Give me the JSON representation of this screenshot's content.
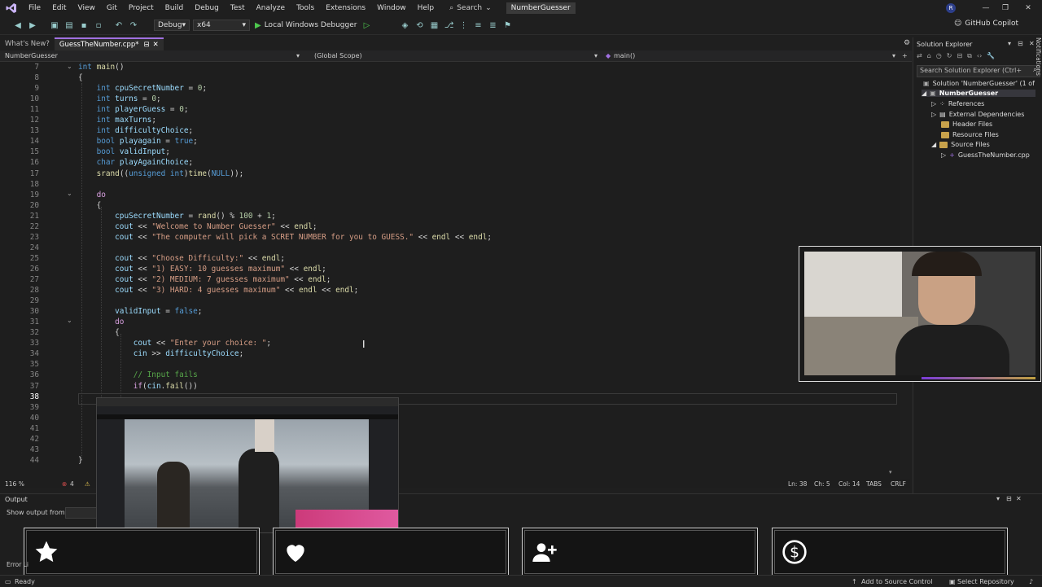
{
  "menubar": {
    "items": [
      "File",
      "Edit",
      "View",
      "Git",
      "Project",
      "Build",
      "Debug",
      "Test",
      "Analyze",
      "Tools",
      "Extensions",
      "Window",
      "Help"
    ],
    "search_label": "Search",
    "solution_title": "NumberGuesser",
    "avatar": "R",
    "copilot_label": "GitHub Copilot"
  },
  "toolbar": {
    "config": "Debug",
    "platform": "x64",
    "run_label": "Local Windows Debugger"
  },
  "tabs": {
    "whats_new": "What's New?",
    "active_file": "GuessTheNumber.cpp*"
  },
  "navbar": {
    "project": "NumberGuesser",
    "scope": "(Global Scope)",
    "function": "main()"
  },
  "code": {
    "lines": [
      {
        "n": "7",
        "html": "<span class=\"kw\">int</span> <span class=\"fn\">main</span>()"
      },
      {
        "n": "8",
        "html": "{"
      },
      {
        "n": "9",
        "html": "    <span class=\"kw\">int</span> <span class=\"var\">cpuSecretNumber</span> = <span class=\"num\">0</span>;"
      },
      {
        "n": "10",
        "html": "    <span class=\"kw\">int</span> <span class=\"var\">turns</span> = <span class=\"num\">0</span>;"
      },
      {
        "n": "11",
        "html": "    <span class=\"kw\">int</span> <span class=\"var\">playerGuess</span> = <span class=\"num\">0</span>;"
      },
      {
        "n": "12",
        "html": "    <span class=\"kw\">int</span> <span class=\"var\">maxTurns</span>;"
      },
      {
        "n": "13",
        "html": "    <span class=\"kw\">int</span> <span class=\"var\">difficultyChoice</span>;"
      },
      {
        "n": "14",
        "html": "    <span class=\"kw\">bool</span> <span class=\"var\">playagain</span> = <span class=\"kw\">true</span>;"
      },
      {
        "n": "15",
        "html": "    <span class=\"kw\">bool</span> <span class=\"var\">validInput</span>;"
      },
      {
        "n": "16",
        "html": "    <span class=\"kw\">char</span> <span class=\"var\">playAgainChoice</span>;"
      },
      {
        "n": "17",
        "html": "    <span class=\"fn\">srand</span>((<span class=\"kw\">unsigned int</span>)<span class=\"fn\">time</span>(<span class=\"kw\">NULL</span>));"
      },
      {
        "n": "18",
        "html": ""
      },
      {
        "n": "19",
        "html": "    <span class=\"ctl\">do</span>"
      },
      {
        "n": "20",
        "html": "    {"
      },
      {
        "n": "21",
        "html": "        <span class=\"var\">cpuSecretNumber</span> = <span class=\"fn\">rand</span>() % <span class=\"num\">100</span> + <span class=\"num\">1</span>;"
      },
      {
        "n": "22",
        "html": "        <span class=\"var\">cout</span> &lt;&lt; <span class=\"str\">\"Welcome to Number Guesser\"</span> &lt;&lt; <span class=\"fn\">endl</span>;"
      },
      {
        "n": "23",
        "html": "        <span class=\"var\">cout</span> &lt;&lt; <span class=\"str\">\"The computer will pick a SCRET NUMBER for you to GUESS.\"</span> &lt;&lt; <span class=\"fn\">endl</span> &lt;&lt; <span class=\"fn\">endl</span>;"
      },
      {
        "n": "24",
        "html": ""
      },
      {
        "n": "25",
        "html": "        <span class=\"var\">cout</span> &lt;&lt; <span class=\"str\">\"Choose Difficulty:\"</span> &lt;&lt; <span class=\"fn\">endl</span>;"
      },
      {
        "n": "26",
        "html": "        <span class=\"var\">cout</span> &lt;&lt; <span class=\"str\">\"1) EASY: 10 guesses maximum\"</span> &lt;&lt; <span class=\"fn\">endl</span>;"
      },
      {
        "n": "27",
        "html": "        <span class=\"var\">cout</span> &lt;&lt; <span class=\"str\">\"2) MEDIUM: 7 guesses maximum\"</span> &lt;&lt; <span class=\"fn\">endl</span>;"
      },
      {
        "n": "28",
        "html": "        <span class=\"var\">cout</span> &lt;&lt; <span class=\"str\">\"3) HARD: 4 guesses maximum\"</span> &lt;&lt; <span class=\"fn\">endl</span> &lt;&lt; <span class=\"fn\">endl</span>;"
      },
      {
        "n": "29",
        "html": ""
      },
      {
        "n": "30",
        "html": "        <span class=\"var\">validInput</span> = <span class=\"kw\">false</span>;"
      },
      {
        "n": "31",
        "html": "        <span class=\"ctl\">do</span>"
      },
      {
        "n": "32",
        "html": "        {"
      },
      {
        "n": "33",
        "html": "            <span class=\"var\">cout</span> &lt;&lt; <span class=\"str\">\"Enter your choice: \"</span>;"
      },
      {
        "n": "34",
        "html": "            <span class=\"var\">cin</span> &gt;&gt; <span class=\"var\">difficultyChoice</span>;"
      },
      {
        "n": "35",
        "html": ""
      },
      {
        "n": "36",
        "html": "            <span class=\"cmt\">// Input fails</span>"
      },
      {
        "n": "37",
        "html": "            <span class=\"ctl\">if</span>(<span class=\"var\">cin</span>.<span class=\"fn\">fail</span>())"
      },
      {
        "n": "38",
        "html": ""
      },
      {
        "n": "39",
        "html": ""
      },
      {
        "n": "40",
        "html": ""
      },
      {
        "n": "41",
        "html": ""
      },
      {
        "n": "42",
        "html": ""
      },
      {
        "n": "43",
        "html": ""
      },
      {
        "n": "44",
        "html": "}"
      }
    ]
  },
  "editor_status": {
    "zoom": "116 %",
    "errors": "4",
    "ln": "Ln: 38",
    "ch": "Ch: 5",
    "col": "Col: 14",
    "tabs": "TABS",
    "eol": "CRLF"
  },
  "solution_explorer": {
    "title": "Solution Explorer",
    "search_placeholder": "Search Solution Explorer (Ctrl+",
    "solution": "Solution 'NumberGuesser' (1 of",
    "project": "NumberGuesser",
    "items": [
      "References",
      "External Dependencies",
      "Header Files",
      "Resource Files",
      "Source Files"
    ],
    "file": "GuessTheNumber.cpp"
  },
  "notifications_label": "Notifications",
  "output": {
    "title": "Output",
    "show_from": "Show output from:"
  },
  "status": {
    "ready": "Ready",
    "error_list": "Error Li",
    "add_source": "Add to Source Control",
    "select_repo": "Select Repository"
  },
  "colors": {
    "accent": "#a070e0",
    "keyword": "#569cd6",
    "string": "#d69d85",
    "comment": "#57a64a"
  }
}
